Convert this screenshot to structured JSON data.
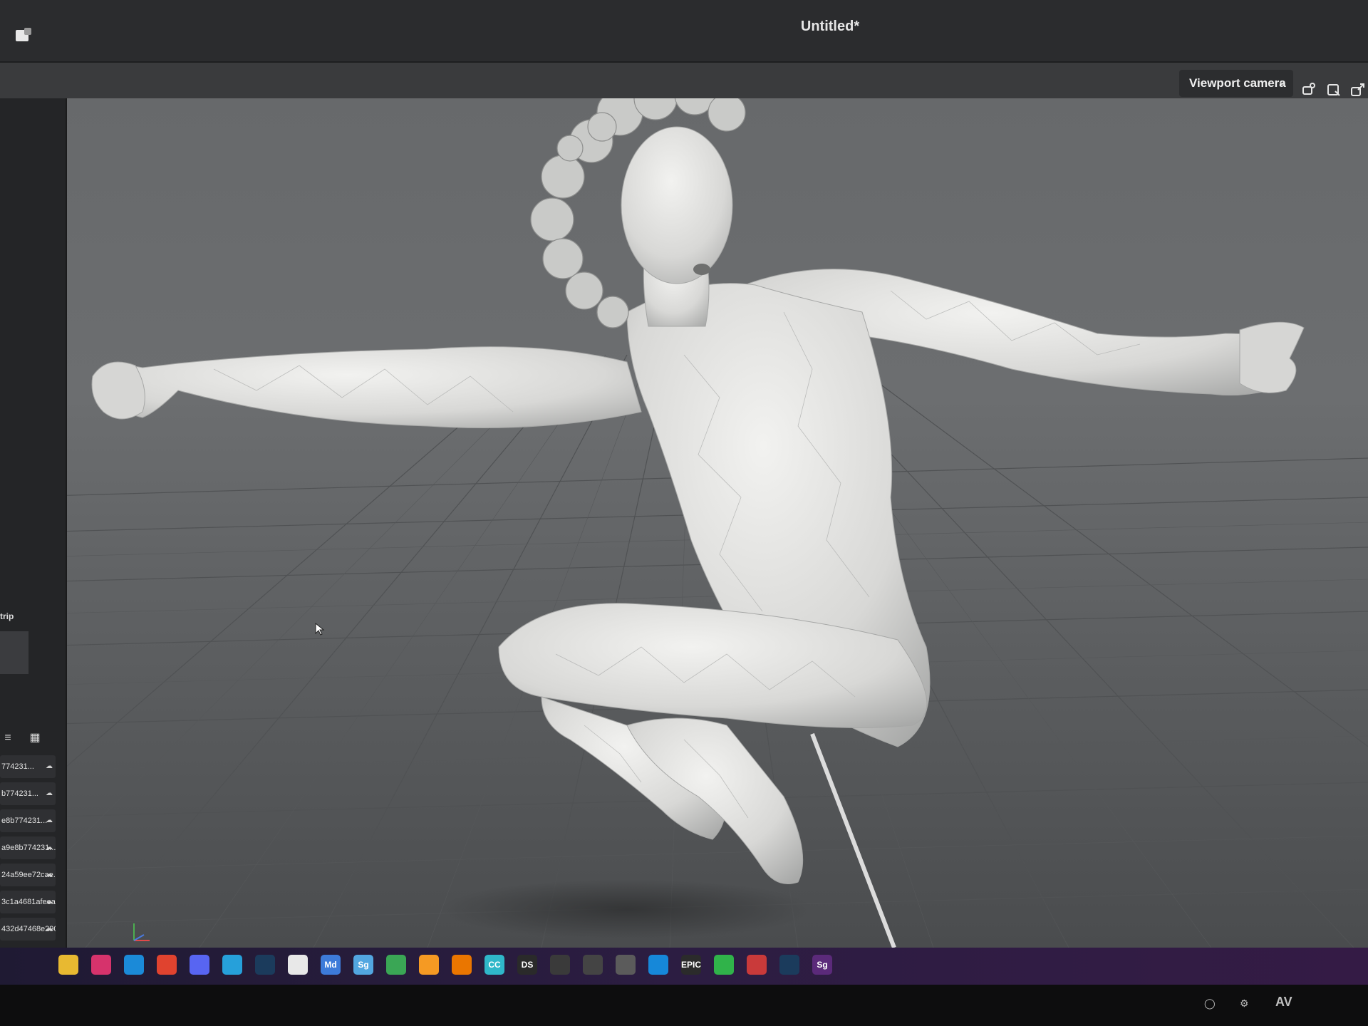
{
  "window": {
    "title": "Untitled*"
  },
  "toolbar": {
    "camera_select_value": "Viewport camera",
    "icons": [
      "camera-icon",
      "frame-icon",
      "export-icon"
    ]
  },
  "left_panel": {
    "strip_label": "trip",
    "items": [
      {
        "label": "774231..."
      },
      {
        "label": "b774231..."
      },
      {
        "label": "e8b774231..."
      },
      {
        "label": "a9e8b774231..."
      },
      {
        "label": "24a59ee72cae..."
      },
      {
        "label": "3c1a4681afeeaf9c..."
      },
      {
        "label": "432d47468e290e2..."
      }
    ],
    "footer_buttons": [
      "+",
      "folder",
      "trash",
      "..."
    ]
  },
  "taskbar": {
    "apps": [
      {
        "name": "file-explorer",
        "label": "",
        "color": "#e8b931"
      },
      {
        "name": "photos",
        "label": "",
        "color": "#d6336c"
      },
      {
        "name": "edge",
        "label": "",
        "color": "#1b8ad8"
      },
      {
        "name": "chrome",
        "label": "",
        "color": "#e0432f"
      },
      {
        "name": "discord",
        "label": "",
        "color": "#5865f2"
      },
      {
        "name": "vr",
        "label": "",
        "color": "#26a0da"
      },
      {
        "name": "steam",
        "label": "",
        "color": "#1b3b5c"
      },
      {
        "name": "oculus",
        "label": "",
        "color": "#e8e8e8"
      },
      {
        "name": "md",
        "label": "Md",
        "color": "#3d7bd9"
      },
      {
        "name": "sg",
        "label": "Sg",
        "color": "#52a6e0"
      },
      {
        "name": "palette",
        "label": "",
        "color": "#3aa655"
      },
      {
        "name": "blizzard",
        "label": "",
        "color": "#f59a23"
      },
      {
        "name": "blender",
        "label": "",
        "color": "#ea7600"
      },
      {
        "name": "cc",
        "label": "CC",
        "color": "#2fb7c9"
      },
      {
        "name": "ds",
        "label": "DS",
        "color": "#2a2a2a"
      },
      {
        "name": "unity",
        "label": "",
        "color": "#3a3a3a"
      },
      {
        "name": "obs",
        "label": "",
        "color": "#444444"
      },
      {
        "name": "vmware",
        "label": "",
        "color": "#5b5b5b"
      },
      {
        "name": "app-blue",
        "label": "",
        "color": "#1688d9"
      },
      {
        "name": "epic",
        "label": "EPIC",
        "color": "#2b2b2b"
      },
      {
        "name": "play",
        "label": "",
        "color": "#30b34a"
      },
      {
        "name": "daz",
        "label": "",
        "color": "#c93a3a"
      },
      {
        "name": "steam2",
        "label": "",
        "color": "#1b3b5c"
      },
      {
        "name": "sg2",
        "label": "Sg",
        "color": "#5b2a7a"
      }
    ]
  },
  "system_tray": {
    "text": "AV"
  }
}
